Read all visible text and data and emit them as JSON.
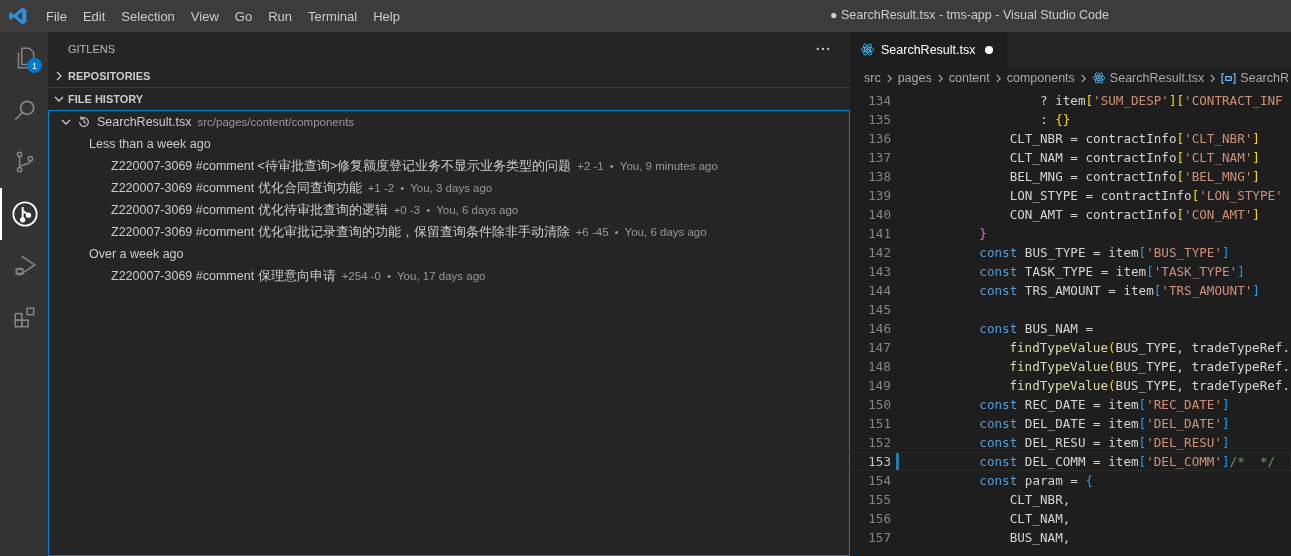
{
  "menu": [
    "File",
    "Edit",
    "Selection",
    "View",
    "Go",
    "Run",
    "Terminal",
    "Help"
  ],
  "window": {
    "title": "● SearchResult.tsx - tms-app - Visual Studio Code"
  },
  "activity_bar": [
    {
      "kind": "files",
      "selected": false,
      "badge": "1"
    },
    {
      "kind": "search",
      "selected": false
    },
    {
      "kind": "source-control",
      "selected": false
    },
    {
      "kind": "gitlens",
      "selected": true
    },
    {
      "kind": "run-debug",
      "selected": false
    },
    {
      "kind": "extensions",
      "selected": false
    }
  ],
  "sidebar": {
    "title": "GITLENS",
    "sections": [
      {
        "label": "REPOSITORIES",
        "expanded": false
      },
      {
        "label": "FILE HISTORY",
        "expanded": true
      }
    ],
    "file": {
      "name": "SearchResult.tsx",
      "path": "src/pages/content/components",
      "expanded": true
    },
    "groups": [
      {
        "label": "Less than a week ago",
        "commits": [
          {
            "message": "Z220007-3069 #comment <待审批查询>修复额度登记业务不显示业务类型的问题",
            "changes": "+2 -1",
            "separator": "•",
            "when": "You, 9 minutes ago"
          },
          {
            "message": "Z220007-3069 #comment 优化合同查询功能",
            "changes": "+1 -2",
            "separator": "•",
            "when": "You, 3 days ago"
          },
          {
            "message": "Z220007-3069 #comment 优化待审批查询的逻辑",
            "changes": "+0 -3",
            "separator": "•",
            "when": "You, 6 days ago"
          },
          {
            "message": "Z220007-3069 #comment 优化审批记录查询的功能，保留查询条件除非手动清除",
            "changes": "+6 -45",
            "separator": "•",
            "when": "You, 6 days ago"
          }
        ]
      },
      {
        "label": "Over a week ago",
        "commits": [
          {
            "message": "Z220007-3069 #comment 保理意向申请",
            "changes": "+254 -0",
            "separator": "•",
            "when": "You, 17 days ago"
          }
        ]
      }
    ]
  },
  "editor": {
    "tab": {
      "label": "SearchResult.tsx",
      "modified": true
    },
    "breadcrumbs": [
      {
        "label": "src",
        "kind": "folder"
      },
      {
        "label": "pages",
        "kind": "folder"
      },
      {
        "label": "content",
        "kind": "folder"
      },
      {
        "label": "components",
        "kind": "folder"
      },
      {
        "label": "SearchResult.tsx",
        "kind": "react"
      },
      {
        "label": "SearchR",
        "kind": "symbol"
      }
    ],
    "lines": [
      {
        "number": "134",
        "current": false,
        "kind": "deep",
        "tokens": [
          {
            "kind": "plain",
            "text": "? item"
          },
          {
            "kind": "br1",
            "text": "["
          },
          {
            "kind": "str",
            "text": "'SUM_DESP'"
          },
          {
            "kind": "br1",
            "text": "]["
          },
          {
            "kind": "str",
            "text": "'CONTRACT_INF"
          }
        ]
      },
      {
        "number": "135",
        "current": false,
        "kind": "deep",
        "tokens": [
          {
            "kind": "plain",
            "text": ": "
          },
          {
            "kind": "br1",
            "text": "{}"
          }
        ]
      },
      {
        "number": "136",
        "current": false,
        "kind": "middle",
        "tokens": [
          {
            "kind": "plain",
            "text": "CLT_NBR = contractInfo"
          },
          {
            "kind": "br1",
            "text": "["
          },
          {
            "kind": "str",
            "text": "'CLT_NBR'"
          },
          {
            "kind": "br1",
            "text": "]"
          }
        ]
      },
      {
        "number": "137",
        "current": false,
        "kind": "middle",
        "tokens": [
          {
            "kind": "plain",
            "text": "CLT_NAM = contractInfo"
          },
          {
            "kind": "br1",
            "text": "["
          },
          {
            "kind": "str",
            "text": "'CLT_NAM'"
          },
          {
            "kind": "br1",
            "text": "]"
          }
        ]
      },
      {
        "number": "138",
        "current": false,
        "kind": "middle",
        "tokens": [
          {
            "kind": "plain",
            "text": "BEL_MNG = contractInfo"
          },
          {
            "kind": "br1",
            "text": "["
          },
          {
            "kind": "str",
            "text": "'BEL_MNG'"
          },
          {
            "kind": "br1",
            "text": "]"
          }
        ]
      },
      {
        "number": "139",
        "current": false,
        "kind": "middle",
        "tokens": [
          {
            "kind": "plain",
            "text": "LON_STYPE = contractInfo"
          },
          {
            "kind": "br1",
            "text": "["
          },
          {
            "kind": "str",
            "text": "'LON_STYPE'"
          }
        ]
      },
      {
        "number": "140",
        "current": false,
        "kind": "middle",
        "tokens": [
          {
            "kind": "plain",
            "text": "CON_AMT = contractInfo"
          },
          {
            "kind": "br1",
            "text": "["
          },
          {
            "kind": "str",
            "text": "'CON_AMT'"
          },
          {
            "kind": "br1",
            "text": "]"
          }
        ]
      },
      {
        "number": "141",
        "current": false,
        "kind": "shallow",
        "tokens": [
          {
            "kind": "br2",
            "text": "}"
          }
        ]
      },
      {
        "number": "142",
        "current": false,
        "kind": "shallow",
        "tokens": [
          {
            "kind": "kw",
            "text": "const"
          },
          {
            "kind": "plain",
            "text": " BUS_TYPE = item"
          },
          {
            "kind": "br3",
            "text": "["
          },
          {
            "kind": "str",
            "text": "'BUS_TYPE'"
          },
          {
            "kind": "br3",
            "text": "]"
          }
        ]
      },
      {
        "number": "143",
        "current": false,
        "kind": "shallow",
        "tokens": [
          {
            "kind": "kw",
            "text": "const"
          },
          {
            "kind": "plain",
            "text": " TASK_TYPE = item"
          },
          {
            "kind": "br3",
            "text": "["
          },
          {
            "kind": "str",
            "text": "'TASK_TYPE'"
          },
          {
            "kind": "br3",
            "text": "]"
          }
        ]
      },
      {
        "number": "144",
        "current": false,
        "kind": "shallow",
        "tokens": [
          {
            "kind": "kw",
            "text": "const"
          },
          {
            "kind": "plain",
            "text": " TRS_AMOUNT = item"
          },
          {
            "kind": "br3",
            "text": "["
          },
          {
            "kind": "str",
            "text": "'TRS_AMOUNT'"
          },
          {
            "kind": "br3",
            "text": "]"
          }
        ]
      },
      {
        "number": "145",
        "current": false
      },
      {
        "number": "146",
        "current": false,
        "kind": "shallow",
        "tokens": [
          {
            "kind": "kw",
            "text": "const"
          },
          {
            "kind": "plain",
            "text": " BUS_NAM ="
          }
        ]
      },
      {
        "number": "147",
        "current": false,
        "kind": "middle",
        "tokens": [
          {
            "kind": "fn",
            "text": "findTypeValue"
          },
          {
            "kind": "br1",
            "text": "("
          },
          {
            "kind": "plain",
            "text": "BUS_TYPE, tradeTypeRef."
          }
        ]
      },
      {
        "number": "148",
        "current": false,
        "kind": "middle",
        "tokens": [
          {
            "kind": "fn",
            "text": "findTypeValue"
          },
          {
            "kind": "br1",
            "text": "("
          },
          {
            "kind": "plain",
            "text": "BUS_TYPE, tradeTypeRef."
          }
        ]
      },
      {
        "number": "149",
        "current": false,
        "kind": "middle",
        "tokens": [
          {
            "kind": "fn",
            "text": "findTypeValue"
          },
          {
            "kind": "br1",
            "text": "("
          },
          {
            "kind": "plain",
            "text": "BUS_TYPE, tradeTypeRef."
          }
        ]
      },
      {
        "number": "150",
        "current": false,
        "kind": "shallow",
        "tokens": [
          {
            "kind": "kw",
            "text": "const"
          },
          {
            "kind": "plain",
            "text": " REC_DATE = item"
          },
          {
            "kind": "br3",
            "text": "["
          },
          {
            "kind": "str",
            "text": "'REC_DATE'"
          },
          {
            "kind": "br3",
            "text": "]"
          }
        ]
      },
      {
        "number": "151",
        "current": false,
        "kind": "shallow",
        "tokens": [
          {
            "kind": "kw",
            "text": "const"
          },
          {
            "kind": "plain",
            "text": " DEL_DATE = item"
          },
          {
            "kind": "br3",
            "text": "["
          },
          {
            "kind": "str",
            "text": "'DEL_DATE'"
          },
          {
            "kind": "br3",
            "text": "]"
          }
        ]
      },
      {
        "number": "152",
        "current": false,
        "kind": "shallow",
        "tokens": [
          {
            "kind": "kw",
            "text": "const"
          },
          {
            "kind": "plain",
            "text": " DEL_RESU = item"
          },
          {
            "kind": "br3",
            "text": "["
          },
          {
            "kind": "str",
            "text": "'DEL_RESU'"
          },
          {
            "kind": "br3",
            "text": "]"
          }
        ]
      },
      {
        "number": "153",
        "current": true,
        "kind": "shallow",
        "tokens": [
          {
            "kind": "kw",
            "text": "const"
          },
          {
            "kind": "plain",
            "text": " DEL_COMM = item"
          },
          {
            "kind": "br3",
            "text": "["
          },
          {
            "kind": "str",
            "text": "'DEL_COMM'"
          },
          {
            "kind": "br3",
            "text": "]"
          },
          {
            "kind": "cmt",
            "text": "/*  */"
          }
        ]
      },
      {
        "number": "154",
        "current": false,
        "kind": "shallow",
        "tokens": [
          {
            "kind": "kw",
            "text": "const"
          },
          {
            "kind": "plain",
            "text": " param = "
          },
          {
            "kind": "br3",
            "text": "{"
          }
        ]
      },
      {
        "number": "155",
        "current": false,
        "kind": "middle",
        "tokens": [
          {
            "kind": "plain",
            "text": "CLT_NBR,"
          }
        ]
      },
      {
        "number": "156",
        "current": false,
        "kind": "middle",
        "tokens": [
          {
            "kind": "plain",
            "text": "CLT_NAM,"
          }
        ]
      },
      {
        "number": "157",
        "current": false,
        "kind": "middle",
        "tokens": [
          {
            "kind": "plain",
            "text": "BUS_NAM,"
          }
        ]
      }
    ]
  }
}
